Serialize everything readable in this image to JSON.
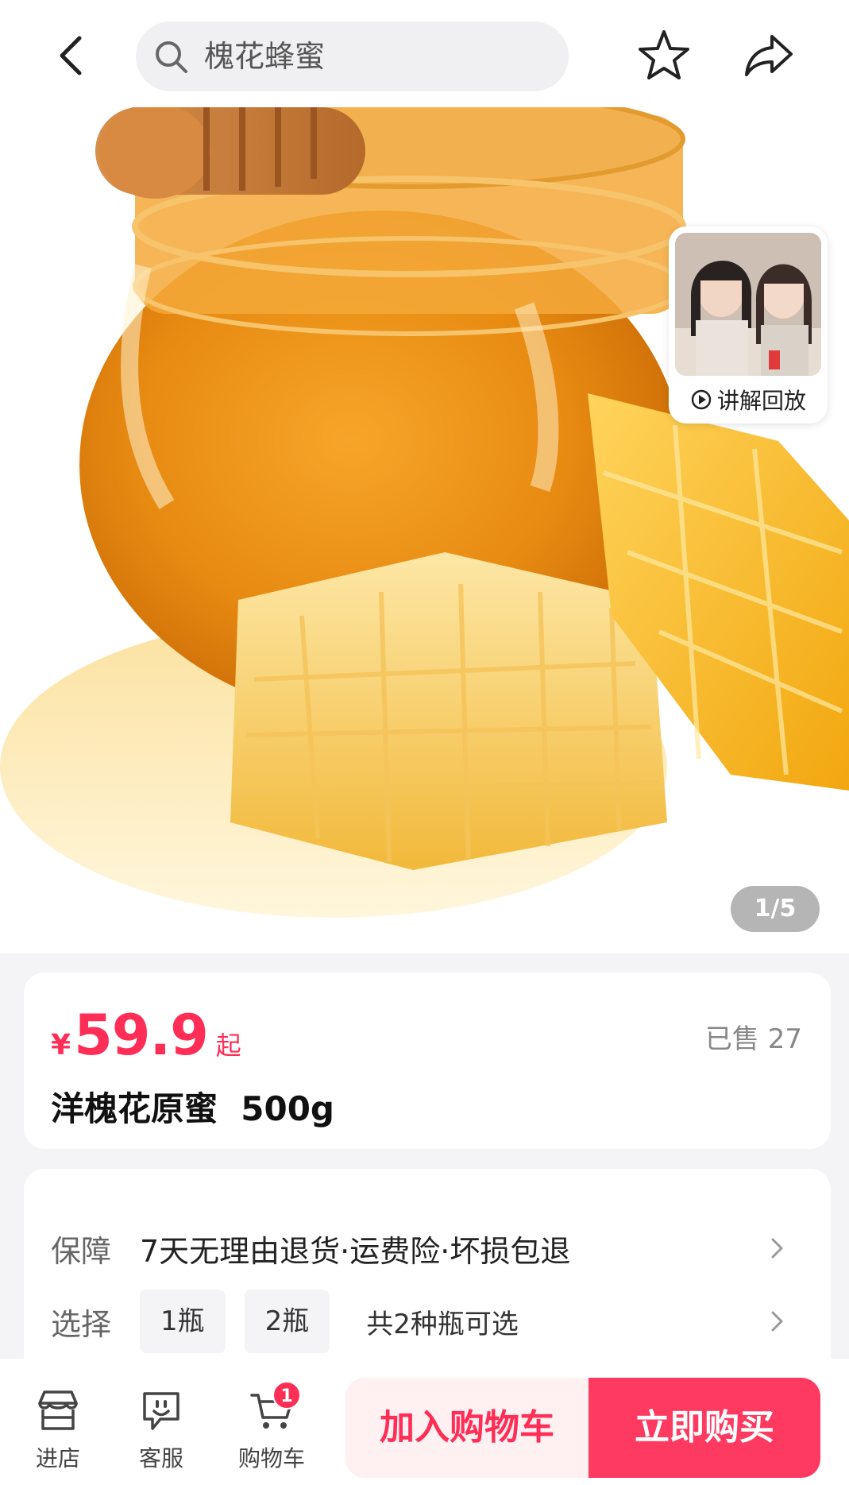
{
  "header": {
    "search_text": "槐花蜂蜜",
    "icons": [
      "back-arrow-icon",
      "search-icon",
      "star-icon",
      "share-icon"
    ]
  },
  "hero": {
    "live_replay_label": "讲解回放",
    "page_indicator": "1/5"
  },
  "product": {
    "currency": "¥",
    "price": "59.9",
    "price_suffix": "起",
    "sold": "已售 27",
    "title": "洋槐花原蜜  500g"
  },
  "info": {
    "guarantee_key": "保障",
    "guarantee_value": "7天无理由退货·运费险·坏损包退",
    "select_key": "选择",
    "specs": [
      "1瓶",
      "2瓶"
    ],
    "spec_count": "共2种瓶可选"
  },
  "bottom_bar": {
    "shop_label": "进店",
    "service_label": "客服",
    "cart_label": "购物车",
    "cart_badge": "1",
    "add_to_cart_label": "加入购物车",
    "buy_now_label": "立即购买"
  },
  "colors": {
    "accent": "#ff2e56",
    "buy_button": "#ff3a60",
    "add_cart_bg": "#fff0f2",
    "page_bg": "#f4f4f6"
  }
}
